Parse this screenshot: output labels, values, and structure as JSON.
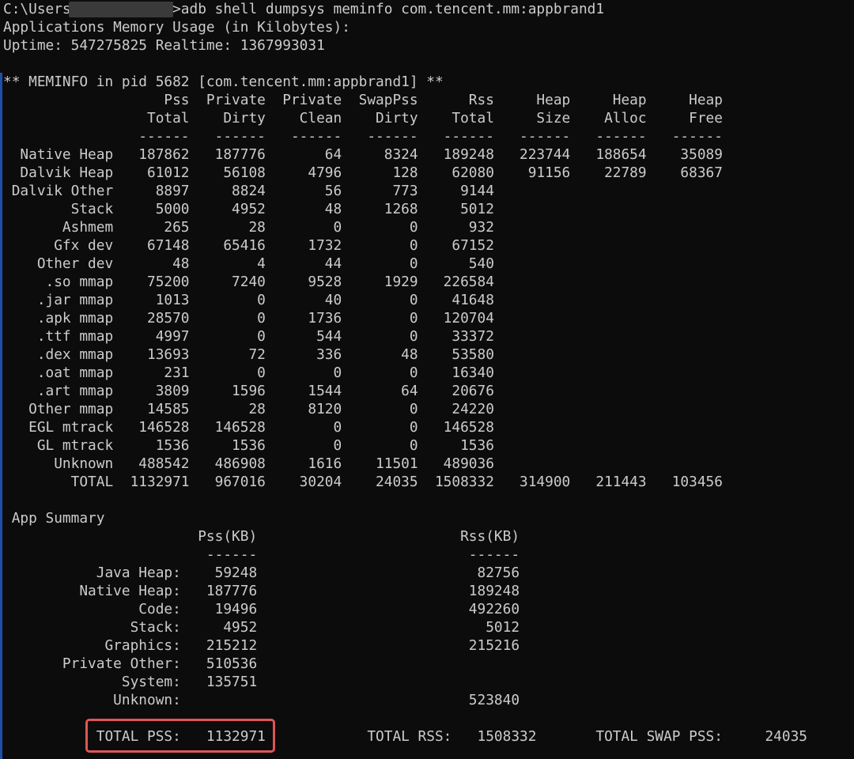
{
  "colors": {
    "background": "#0c0c0c",
    "text": "#cccccc",
    "highlight": "#e05555",
    "left_edge": "#1f4fa8"
  },
  "lines": [
    "C:\\Users\\           >adb shell dumpsys meminfo com.tencent.mm:appbrand1",
    "Applications Memory Usage (in Kilobytes):",
    "Uptime: 547275825 Realtime: 1367993031",
    "",
    "** MEMINFO in pid 5682 [com.tencent.mm:appbrand1] **",
    "                   Pss  Private  Private  SwapPss      Rss     Heap     Heap     Heap",
    "                 Total    Dirty    Clean    Dirty    Total     Size    Alloc     Free",
    "                ------   ------   ------   ------   ------   ------   ------   ------",
    "  Native Heap   187862   187776       64     8324   189248   223744   188654    35089",
    "  Dalvik Heap    61012    56108     4796      128    62080    91156    22789    68367",
    " Dalvik Other     8897     8824       56      773     9144",
    "        Stack     5000     4952       48     1268     5012",
    "       Ashmem      265       28        0        0      932",
    "      Gfx dev    67148    65416     1732        0    67152",
    "    Other dev       48        4       44        0      540",
    "     .so mmap    75200     7240     9528     1929   226584",
    "    .jar mmap     1013        0       40        0    41648",
    "    .apk mmap    28570        0     1736        0   120704",
    "    .ttf mmap     4997        0      544        0    33372",
    "    .dex mmap    13693       72      336       48    53580",
    "    .oat mmap      231        0        0        0    16340",
    "    .art mmap     3809     1596     1544       64    20676",
    "   Other mmap    14585       28     8120        0    24220",
    "   EGL mtrack   146528   146528        0        0   146528",
    "    GL mtrack     1536     1536        0        0     1536",
    "      Unknown   488542   486908     1616    11501   489036",
    "        TOTAL  1132971   967016    30204    24035  1508332   314900   211443   103456",
    "",
    " App Summary",
    "                       Pss(KB)                        Rss(KB)",
    "                        ------                         ------",
    "           Java Heap:    59248                          82756",
    "         Native Heap:   187776                         189248",
    "                Code:    19496                         492260",
    "               Stack:     4952                           5012",
    "            Graphics:   215212                         215216",
    "       Private Other:   510536",
    "              System:   135751",
    "             Unknown:                                  523840",
    "",
    "           TOTAL PSS:   1132971            TOTAL RSS:   1508332       TOTAL SWAP PSS:     24035"
  ]
}
